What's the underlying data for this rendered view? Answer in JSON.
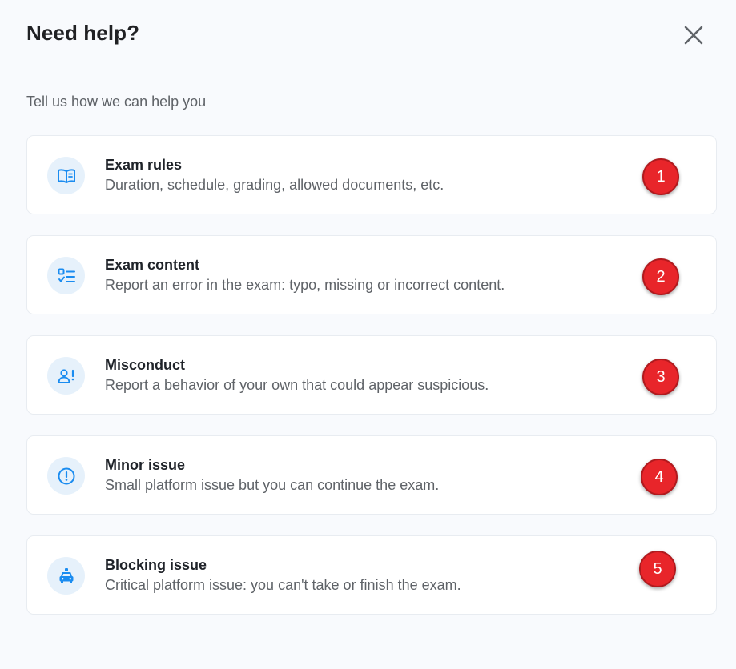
{
  "dialog": {
    "title": "Need help?",
    "subtitle": "Tell us how we can help you",
    "close_icon": "close-icon"
  },
  "colors": {
    "background": "#f8fafd",
    "card": "#ffffff",
    "icon_accent": "#1a8cf0",
    "icon_bg": "#e6f1fb",
    "badge": "#e8252a"
  },
  "options": [
    {
      "title": "Exam rules",
      "description": "Duration, schedule, grading, allowed documents, etc.",
      "icon": "book-icon",
      "badge": "1"
    },
    {
      "title": "Exam content",
      "description": "Report an error in the exam: typo, missing or incorrect content.",
      "icon": "checklist-icon",
      "badge": "2"
    },
    {
      "title": "Misconduct",
      "description": "Report a behavior of your own that could appear suspicious.",
      "icon": "person-alert-icon",
      "badge": "3"
    },
    {
      "title": "Minor issue",
      "description": "Small platform issue but you can continue the exam.",
      "icon": "exclamation-circle-icon",
      "badge": "4"
    },
    {
      "title": "Blocking issue",
      "description": "Critical platform issue: you can't take or finish the exam.",
      "icon": "emergency-car-icon",
      "badge": "5"
    }
  ]
}
